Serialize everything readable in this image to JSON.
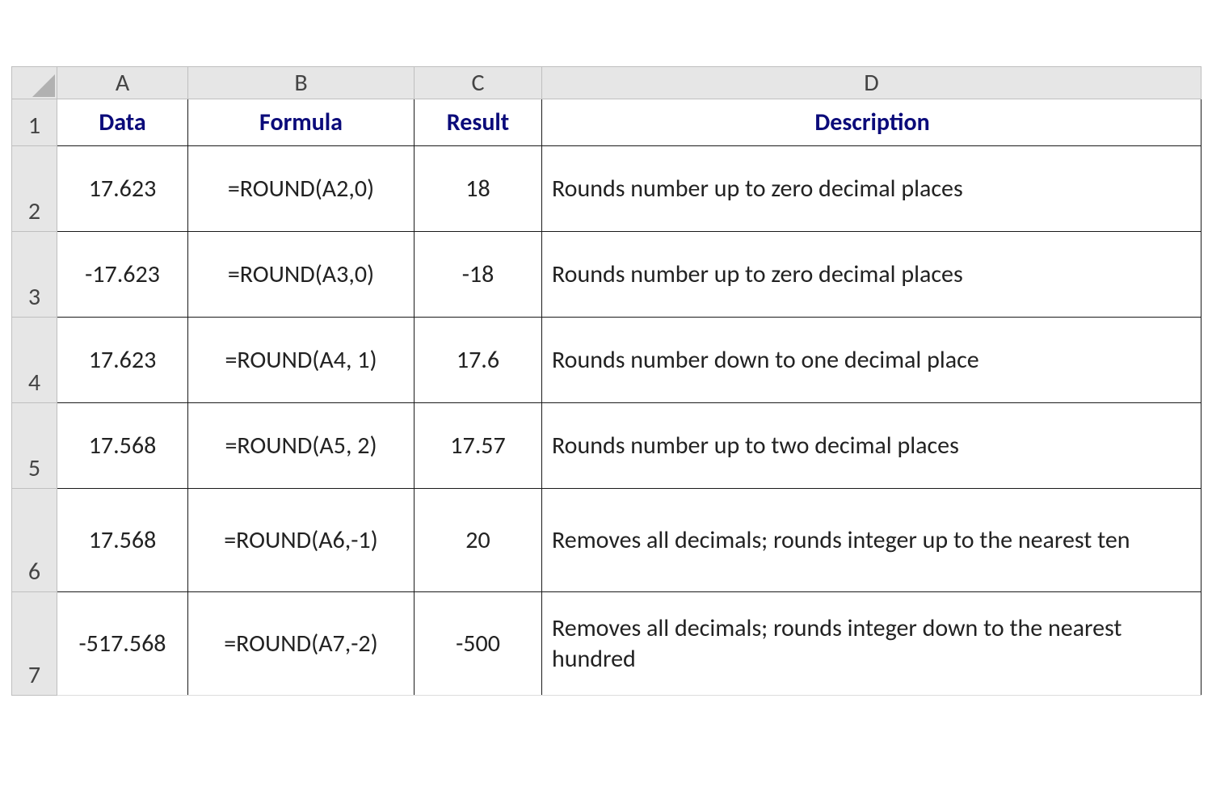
{
  "columns": {
    "A": "A",
    "B": "B",
    "C": "C",
    "D": "D"
  },
  "rowNumbers": [
    "1",
    "2",
    "3",
    "4",
    "5",
    "6",
    "7"
  ],
  "headers": {
    "data": "Data",
    "formula": "Formula",
    "result": "Result",
    "description": "Description"
  },
  "rows": [
    {
      "data": "17.623",
      "formula": "=ROUND(A2,0)",
      "result": "18",
      "description": "Rounds number up to zero decimal places"
    },
    {
      "data": "-17.623",
      "formula": "=ROUND(A3,0)",
      "result": "-18",
      "description": "Rounds number up to zero decimal places"
    },
    {
      "data": "17.623",
      "formula": "=ROUND(A4, 1)",
      "result": "17.6",
      "description": "Rounds number down to one decimal place"
    },
    {
      "data": "17.568",
      "formula": "=ROUND(A5, 2)",
      "result": "17.57",
      "description": "Rounds number up to two decimal places"
    },
    {
      "data": "17.568",
      "formula": "=ROUND(A6,-1)",
      "result": "20",
      "description": "Removes all decimals; rounds integer up to the nearest ten"
    },
    {
      "data": "-517.568",
      "formula": "=ROUND(A7,-2)",
      "result": "-500",
      "description": "Removes all decimals; rounds integer down to the nearest hundred"
    }
  ]
}
